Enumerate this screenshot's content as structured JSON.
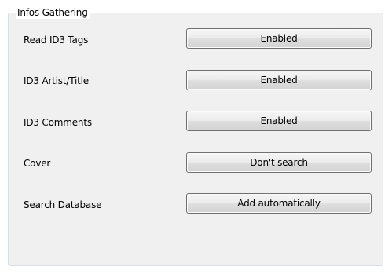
{
  "group": {
    "title": "Infos Gathering"
  },
  "rows": [
    {
      "label": "Read ID3 Tags",
      "value": "Enabled"
    },
    {
      "label": "ID3 Artist/Title",
      "value": "Enabled"
    },
    {
      "label": "ID3 Comments",
      "value": "Enabled"
    },
    {
      "label": "Cover",
      "value": "Don't search"
    },
    {
      "label": "Search Database",
      "value": "Add automatically"
    }
  ]
}
